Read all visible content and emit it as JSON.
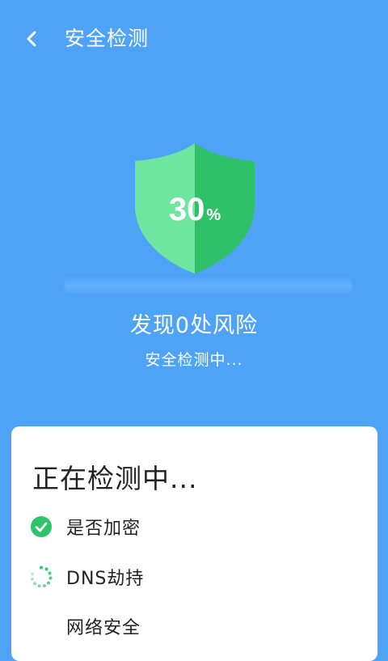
{
  "header": {
    "title": "安全检测"
  },
  "scan": {
    "progress_number": "30",
    "progress_unit": "%",
    "risk_text": "发现0处风险",
    "status_text": "安全检测中..."
  },
  "panel": {
    "title": "正在检测中...",
    "items": [
      {
        "label": "是否加密",
        "state": "done"
      },
      {
        "label": "DNS劫持",
        "state": "loading"
      },
      {
        "label": "网络安全",
        "state": "pending"
      }
    ]
  },
  "colors": {
    "background": "#4fa3f7",
    "shield_light": "#6ee6a0",
    "shield_dark": "#2fc06a",
    "check_green": "#2ec46c"
  }
}
